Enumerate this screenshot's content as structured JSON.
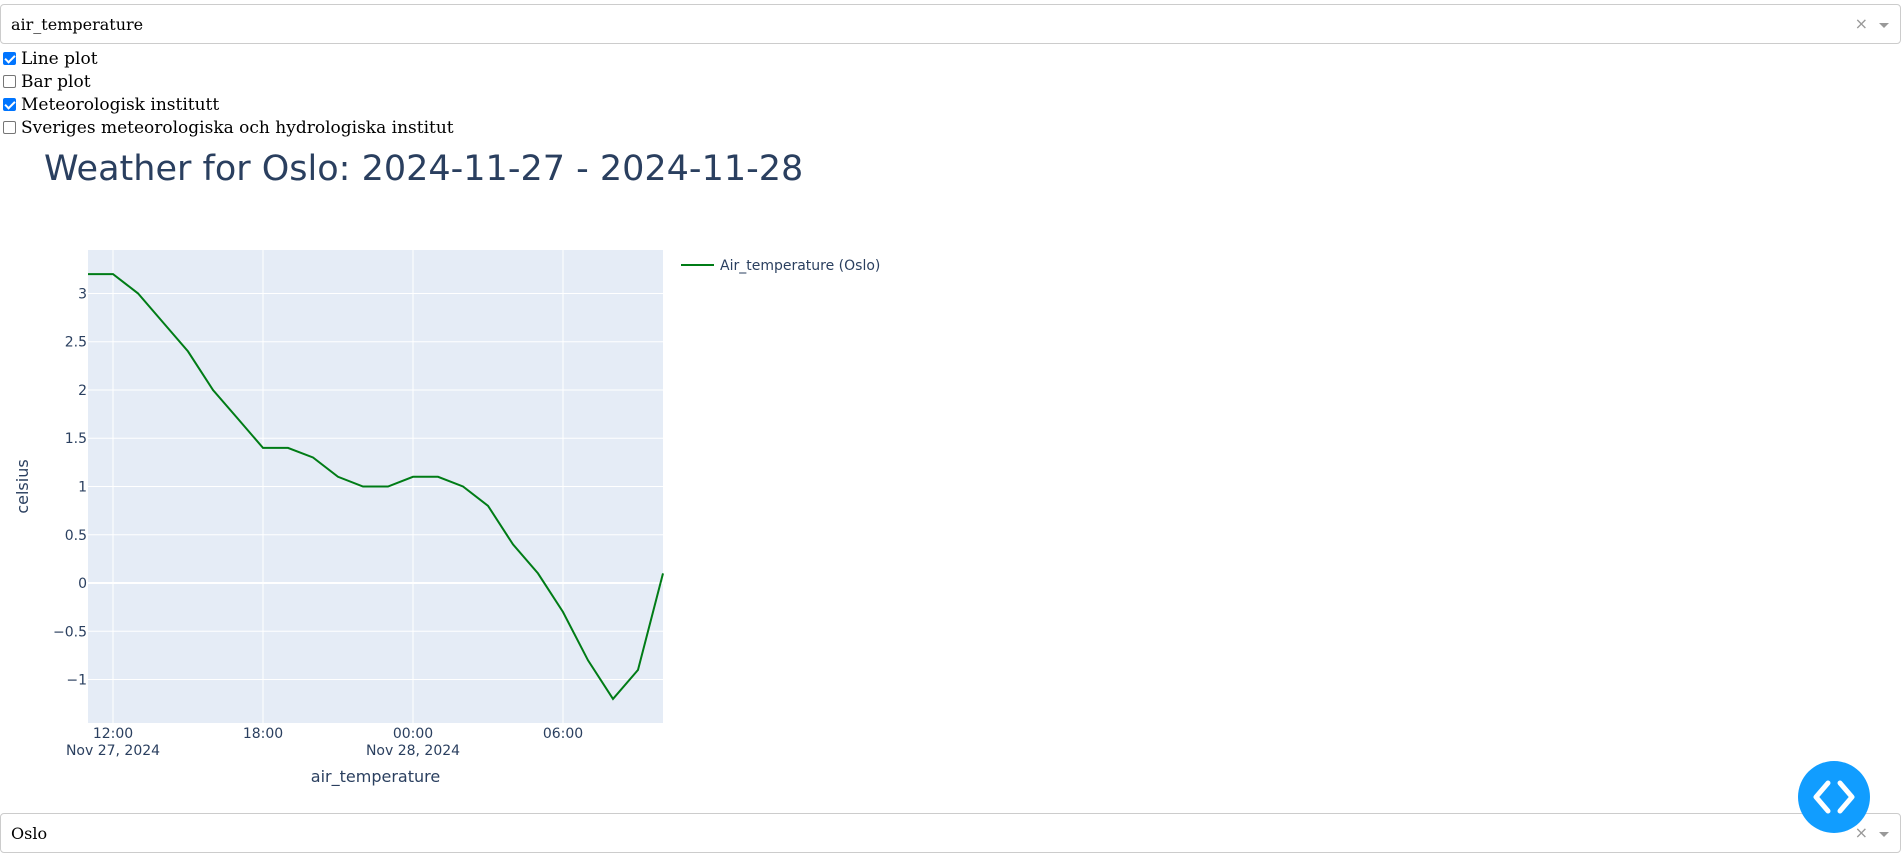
{
  "variable_dropdown": {
    "value": "air_temperature",
    "clear_symbol": "×"
  },
  "checklist": [
    {
      "label": "Line plot",
      "checked": true
    },
    {
      "label": "Bar plot",
      "checked": false
    },
    {
      "label": "Meteorologisk institutt",
      "checked": true
    },
    {
      "label": "Sveriges meteorologiska och hydrologiska institut",
      "checked": false
    }
  ],
  "city_dropdown": {
    "value": "Oslo",
    "clear_symbol": "×"
  },
  "colors": {
    "line": "#007c16",
    "plot_bg": "#e5ecf6",
    "title": "#2a3f5f",
    "fab": "#119dff"
  },
  "icons": {
    "fab": "code-brackets-icon",
    "dropdown_arrow": "chevron-down-icon",
    "clear": "close-icon"
  },
  "chart_data": {
    "type": "line",
    "title": "Weather for Oslo: 2024-11-27 - 2024-11-28",
    "xlabel": "air_temperature",
    "ylabel": "celsius",
    "x_ticks": [
      {
        "time": "2024-11-27T12:00",
        "label": "12:00",
        "sublabel": "Nov 27, 2024"
      },
      {
        "time": "2024-11-27T18:00",
        "label": "18:00",
        "sublabel": ""
      },
      {
        "time": "2024-11-28T00:00",
        "label": "00:00",
        "sublabel": "Nov 28, 2024"
      },
      {
        "time": "2024-11-28T06:00",
        "label": "06:00",
        "sublabel": ""
      }
    ],
    "y_ticks": [
      3,
      2.5,
      2,
      1.5,
      1,
      0.5,
      0,
      -0.5,
      -1
    ],
    "y_tick_labels": [
      "3",
      "2.5",
      "2",
      "1.5",
      "1",
      "0.5",
      "0",
      "−0.5",
      "−1"
    ],
    "xlim": [
      "2024-11-27T11:00",
      "2024-11-28T10:00"
    ],
    "ylim": [
      -1.45,
      3.45
    ],
    "grid": true,
    "legend_position": "top-right",
    "series": [
      {
        "name": "Air_temperature (Oslo)",
        "x": [
          "2024-11-27T11:00",
          "2024-11-27T12:00",
          "2024-11-27T13:00",
          "2024-11-27T14:00",
          "2024-11-27T15:00",
          "2024-11-27T16:00",
          "2024-11-27T17:00",
          "2024-11-27T18:00",
          "2024-11-27T19:00",
          "2024-11-27T20:00",
          "2024-11-27T21:00",
          "2024-11-27T22:00",
          "2024-11-27T23:00",
          "2024-11-28T00:00",
          "2024-11-28T01:00",
          "2024-11-28T02:00",
          "2024-11-28T03:00",
          "2024-11-28T04:00",
          "2024-11-28T05:00",
          "2024-11-28T06:00",
          "2024-11-28T07:00",
          "2024-11-28T08:00",
          "2024-11-28T09:00",
          "2024-11-28T10:00"
        ],
        "values": [
          3.2,
          3.2,
          3.0,
          2.7,
          2.4,
          2.0,
          1.7,
          1.4,
          1.4,
          1.3,
          1.1,
          1.0,
          1.0,
          1.1,
          1.1,
          1.0,
          0.8,
          0.4,
          0.1,
          -0.3,
          -0.8,
          -1.2,
          -0.9,
          0.1
        ]
      }
    ]
  }
}
